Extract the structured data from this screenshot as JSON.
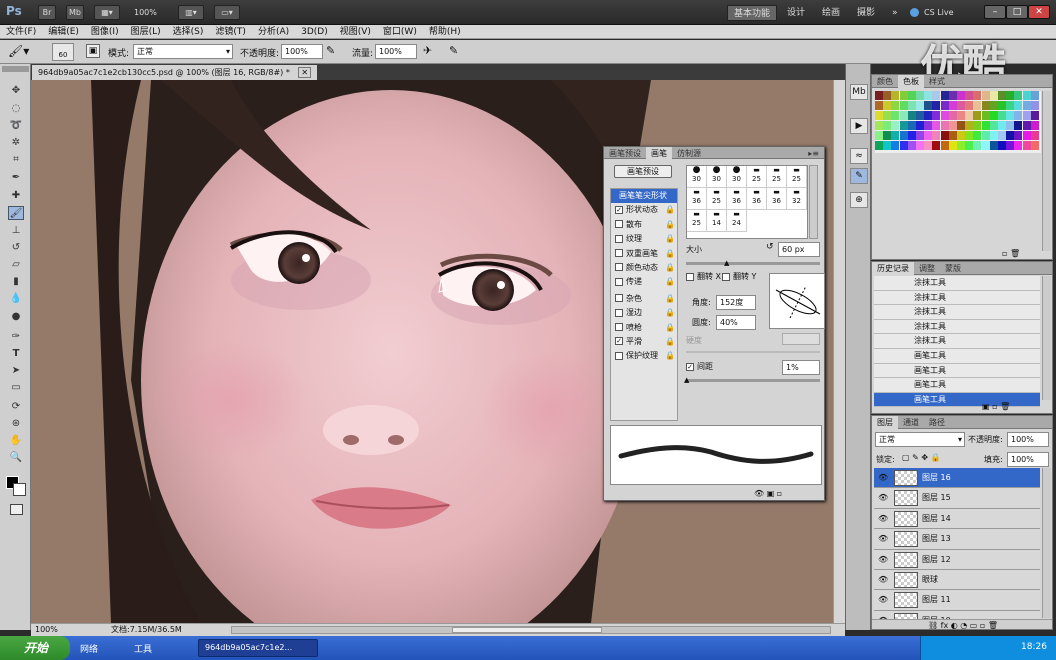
{
  "app": {
    "logo": "Ps",
    "bar_buttons": [
      "Br",
      "Mb"
    ],
    "zoom": "100%",
    "workspaces": [
      "基本功能",
      "设计",
      "绘画",
      "摄影"
    ],
    "cs_live": "CS Live",
    "window_controls": [
      "–",
      "□",
      "✕"
    ]
  },
  "menu": [
    "文件(F)",
    "编辑(E)",
    "图像(I)",
    "图层(L)",
    "选择(S)",
    "滤镜(T)",
    "分析(A)",
    "3D(D)",
    "视图(V)",
    "窗口(W)",
    "帮助(H)"
  ],
  "options": {
    "brush_size": "60",
    "mode_label": "模式:",
    "mode_value": "正常",
    "opacity_label": "不透明度:",
    "opacity_value": "100%",
    "flow_label": "流量:",
    "flow_value": "100%"
  },
  "watermark": "优酷",
  "document": {
    "tab_title": "964db9a05ac7c1e2cb130cc5.psd @ 100% (图层 16, RGB/8#) *",
    "close": "✕",
    "status_zoom": "100%",
    "status_doc": "文档:7.15M/36.5M"
  },
  "brush_panel": {
    "tabs": [
      "画笔预设",
      "画笔",
      "仿制源"
    ],
    "preset_button": "画笔预设",
    "options": [
      {
        "label": "画笔笔尖形状",
        "checked": false,
        "heading": true
      },
      {
        "label": "形状动态",
        "checked": true
      },
      {
        "label": "散布",
        "checked": false
      },
      {
        "label": "纹理",
        "checked": false
      },
      {
        "label": "双重画笔",
        "checked": false
      },
      {
        "label": "颜色动态",
        "checked": false
      },
      {
        "label": "传递",
        "checked": false
      },
      {
        "label": "杂色",
        "checked": false
      },
      {
        "label": "湿边",
        "checked": false
      },
      {
        "label": "喷枪",
        "checked": false
      },
      {
        "label": "平滑",
        "checked": true
      },
      {
        "label": "保护纹理",
        "checked": false
      }
    ],
    "tips": [
      "30",
      "30",
      "30",
      "25",
      "25",
      "25",
      "36",
      "25",
      "36",
      "36",
      "36",
      "32",
      "25",
      "14",
      "24"
    ],
    "size_label": "大小",
    "size_value": "60 px",
    "flip_x": "翻转 X",
    "flip_y": "翻转 Y",
    "angle_label": "角度:",
    "angle_value": "152度",
    "roundness_label": "圆度:",
    "roundness_value": "40%",
    "hardness_label": "硬度",
    "spacing_label": "间距",
    "spacing_value": "1%"
  },
  "color_panel": {
    "tabs": [
      "颜色",
      "色板",
      "样式"
    ]
  },
  "history_panel": {
    "tabs": [
      "历史记录",
      "调整",
      "蒙版"
    ],
    "items": [
      "涂抹工具",
      "涂抹工具",
      "涂抹工具",
      "涂抹工具",
      "涂抹工具",
      "画笔工具",
      "画笔工具",
      "画笔工具",
      "画笔工具"
    ]
  },
  "layers_panel": {
    "tabs": [
      "图层",
      "通道",
      "路径"
    ],
    "blend": "正常",
    "opacity_label": "不透明度:",
    "opacity": "100%",
    "lock_label": "锁定:",
    "fill_label": "填充:",
    "fill": "100%",
    "layers": [
      "图层 16",
      "图层 15",
      "图层 14",
      "图层 13",
      "图层 12",
      "眼球",
      "图层 11",
      "图层 10"
    ]
  },
  "taskbar": {
    "start": "开始",
    "items": [
      "网络",
      "工具"
    ],
    "window": "964db9a05ac7c1e2...",
    "clock": "18:26"
  }
}
